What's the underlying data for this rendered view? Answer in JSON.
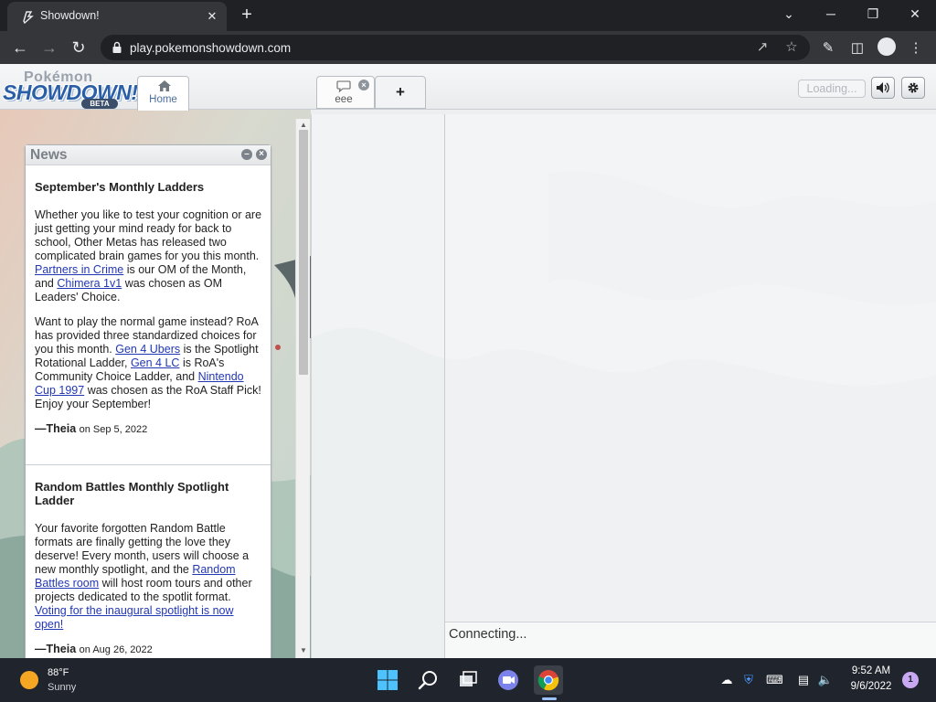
{
  "browser": {
    "tab_title": "Showdown!",
    "tab_close": "✕",
    "new_tab": "+",
    "url": "play.pokemonshowdown.com",
    "window_controls": {
      "chevron": "⌄",
      "minimize": "─",
      "restore": "❐",
      "close": "✕"
    }
  },
  "showdown": {
    "logo": {
      "line1": "Pokémon",
      "line2": "SHOWDOWN!",
      "badge": "BETA"
    },
    "tabs": {
      "home_label": "Home",
      "room_label": "eee",
      "room_close": "×",
      "add_label": "+"
    },
    "header": {
      "loading_label": "Loading...",
      "volume_icon": "volume-icon",
      "settings_icon": "gear-icon"
    },
    "news": {
      "title": "News",
      "minimize": "–",
      "close": "×",
      "post1": {
        "title": "September's Monthly Ladders",
        "p1_a": "Whether you like to test your cognition or are just getting your mind ready for back to school, Other Metas has released two complicated brain games for you this month. ",
        "p1_link1": "Partners in Crime",
        "p1_b": " is our OM of the Month, and ",
        "p1_link2": "Chimera 1v1",
        "p1_c": " was chosen as OM Leaders' Choice.",
        "p2_a": "Want to play the normal game instead? RoA has provided three standardized choices for you this month. ",
        "p2_link1": "Gen 4 Ubers",
        "p2_b": " is the Spotlight Rotational Ladder, ",
        "p2_link2": "Gen 4 LC",
        "p2_c": " is RoA's Community Choice Ladder, and ",
        "p2_link3": "Nintendo Cup 1997",
        "p2_d": " was chosen as the RoA Staff Pick! Enjoy your September!",
        "author": "—Theia",
        "date": "on Sep 5, 2022"
      },
      "post2": {
        "title": "Random Battles Monthly Spotlight Ladder",
        "p1_a": "Your favorite forgotten Random Battle formats are finally getting the love they deserve! Every month, users will choose a new monthly spotlight, and the ",
        "p1_link1": "Random Battles room",
        "p1_b": " will host room tours and other projects dedicated to the spotlit format. ",
        "p1_link2": "Voting for the inaugural spotlight is now open!",
        "author": "—Theia",
        "date": "on Aug 26, 2022"
      }
    },
    "chat": {
      "status": "Connecting..."
    }
  },
  "taskbar": {
    "weather_temp": "88°F",
    "weather_desc": "Sunny",
    "time": "9:52 AM",
    "date": "9/6/2022",
    "notification_count": "1"
  },
  "colors": {
    "chrome_dark": "#202124",
    "chrome_toolbar": "#35363a",
    "ps_link": "#2237b3",
    "ps_logo_blue": "#2a5fa7",
    "taskbar": "#20242c",
    "notification": "#c8a7f3"
  }
}
